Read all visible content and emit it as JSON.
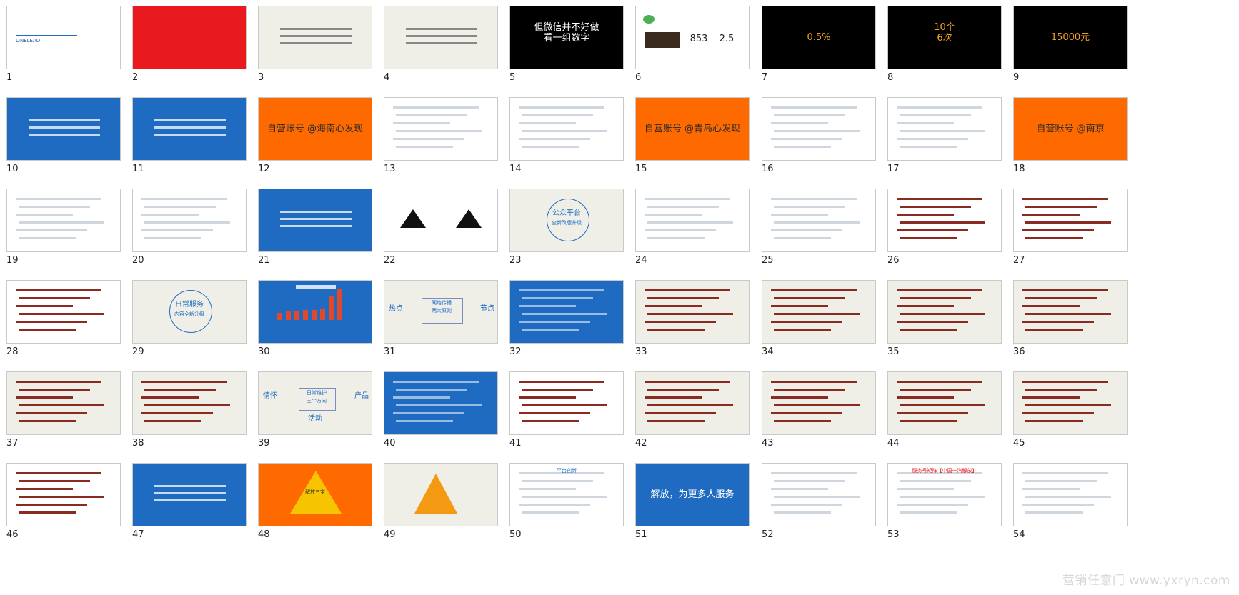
{
  "slides": [
    {
      "n": "1",
      "bg": "#ffffff",
      "kind": "text",
      "lines": [
        "LINELEAD"
      ],
      "color": "#2b57a1"
    },
    {
      "n": "2",
      "bg": "#e8191f",
      "kind": "calligraphy",
      "lines": [],
      "color": "#ffffff"
    },
    {
      "n": "3",
      "bg": "#efefe8",
      "kind": "text",
      "lines": [],
      "color": "#222"
    },
    {
      "n": "4",
      "bg": "#efefe8",
      "kind": "text",
      "lines": [],
      "color": "#222"
    },
    {
      "n": "5",
      "bg": "#000000",
      "kind": "text",
      "lines": [
        "但微信并不好做",
        "看一组数字"
      ],
      "color": "#ffffff"
    },
    {
      "n": "6",
      "bg": "#ffffff",
      "kind": "wechat",
      "lines": [
        "853",
        "2.5"
      ],
      "color": "#222"
    },
    {
      "n": "7",
      "bg": "#000000",
      "kind": "text",
      "lines": [
        "0.5%"
      ],
      "color": "#f0a11b"
    },
    {
      "n": "8",
      "bg": "#000000",
      "kind": "text",
      "lines": [
        "10个",
        "6次"
      ],
      "color": "#f0a11b"
    },
    {
      "n": "9",
      "bg": "#000000",
      "kind": "text",
      "lines": [
        "15000元"
      ],
      "color": "#f0a11b"
    },
    {
      "n": "10",
      "bg": "#1f6bc2",
      "kind": "text",
      "lines": [],
      "color": "#ffffff"
    },
    {
      "n": "11",
      "bg": "#1f6bc2",
      "kind": "text",
      "lines": [],
      "color": "#ffffff"
    },
    {
      "n": "12",
      "bg": "#ff6a00",
      "kind": "text",
      "lines": [
        "自营账号 @海南心发现"
      ],
      "color": "#2b2b2b"
    },
    {
      "n": "13",
      "bg": "#ffffff",
      "kind": "ui",
      "lines": [],
      "color": "#222"
    },
    {
      "n": "14",
      "bg": "#ffffff",
      "kind": "ui",
      "lines": [],
      "color": "#222"
    },
    {
      "n": "15",
      "bg": "#ff6a00",
      "kind": "text",
      "lines": [
        "自营账号 @青岛心发现"
      ],
      "color": "#2b2b2b"
    },
    {
      "n": "16",
      "bg": "#ffffff",
      "kind": "ui",
      "lines": [],
      "color": "#222"
    },
    {
      "n": "17",
      "bg": "#ffffff",
      "kind": "ui",
      "lines": [],
      "color": "#222"
    },
    {
      "n": "18",
      "bg": "#ff6a00",
      "kind": "text",
      "lines": [
        "自营账号 @南京"
      ],
      "color": "#2b2b2b"
    },
    {
      "n": "19",
      "bg": "#ffffff",
      "kind": "ui",
      "lines": [],
      "color": "#222"
    },
    {
      "n": "20",
      "bg": "#ffffff",
      "kind": "ui",
      "lines": [],
      "color": "#222"
    },
    {
      "n": "21",
      "bg": "#1f6bc2",
      "kind": "text",
      "lines": [],
      "color": "#ffffff"
    },
    {
      "n": "22",
      "bg": "#ffffff",
      "kind": "arrows",
      "lines": [],
      "color": "#222"
    },
    {
      "n": "23",
      "bg": "#efefe8",
      "kind": "circle",
      "lines": [
        "公众平台",
        "全新改版升级"
      ],
      "color": "#1f6bc2"
    },
    {
      "n": "24",
      "bg": "#ffffff",
      "kind": "ui",
      "lines": [],
      "color": "#222"
    },
    {
      "n": "25",
      "bg": "#ffffff",
      "kind": "ui",
      "lines": [],
      "color": "#222"
    },
    {
      "n": "26",
      "bg": "#ffffff",
      "kind": "photo",
      "lines": [],
      "color": "#222"
    },
    {
      "n": "27",
      "bg": "#ffffff",
      "kind": "photo",
      "lines": [],
      "color": "#222"
    },
    {
      "n": "28",
      "bg": "#ffffff",
      "kind": "photo",
      "lines": [],
      "color": "#222"
    },
    {
      "n": "29",
      "bg": "#efefe8",
      "kind": "circle",
      "lines": [
        "日常服务",
        "内容全新升级"
      ],
      "color": "#1f6bc2"
    },
    {
      "n": "30",
      "bg": "#1f6bc2",
      "kind": "chart",
      "lines": [],
      "color": "#ffffff"
    },
    {
      "n": "31",
      "bg": "#efefe8",
      "kind": "text",
      "lines": [
        "热点",
        "网络传播",
        "两大原则",
        "节点"
      ],
      "color": "#1f6bc2"
    },
    {
      "n": "32",
      "bg": "#1f6bc2",
      "kind": "ui",
      "lines": [],
      "color": "#ffffff"
    },
    {
      "n": "33",
      "bg": "#efefe8",
      "kind": "photo",
      "lines": [],
      "color": "#222"
    },
    {
      "n": "34",
      "bg": "#efefe8",
      "kind": "photo",
      "lines": [],
      "color": "#222"
    },
    {
      "n": "35",
      "bg": "#efefe8",
      "kind": "photo",
      "lines": [],
      "color": "#222"
    },
    {
      "n": "36",
      "bg": "#efefe8",
      "kind": "photo",
      "lines": [],
      "color": "#222"
    },
    {
      "n": "37",
      "bg": "#efefe8",
      "kind": "photo",
      "lines": [],
      "color": "#222"
    },
    {
      "n": "38",
      "bg": "#efefe8",
      "kind": "photo",
      "lines": [],
      "color": "#222"
    },
    {
      "n": "39",
      "bg": "#efefe8",
      "kind": "text",
      "lines": [
        "情怀",
        "日常维护",
        "三个方向",
        "产品",
        "活动"
      ],
      "color": "#1f6bc2"
    },
    {
      "n": "40",
      "bg": "#1f6bc2",
      "kind": "ui",
      "lines": [],
      "color": "#ffffff"
    },
    {
      "n": "41",
      "bg": "#ffffff",
      "kind": "photo",
      "lines": [],
      "color": "#222"
    },
    {
      "n": "42",
      "bg": "#efefe8",
      "kind": "photo",
      "lines": [],
      "color": "#222"
    },
    {
      "n": "43",
      "bg": "#efefe8",
      "kind": "photo",
      "lines": [],
      "color": "#222"
    },
    {
      "n": "44",
      "bg": "#efefe8",
      "kind": "photo",
      "lines": [],
      "color": "#222"
    },
    {
      "n": "45",
      "bg": "#efefe8",
      "kind": "photo",
      "lines": [],
      "color": "#222"
    },
    {
      "n": "46",
      "bg": "#ffffff",
      "kind": "photo",
      "lines": [],
      "color": "#222"
    },
    {
      "n": "47",
      "bg": "#1f6bc2",
      "kind": "text",
      "lines": [],
      "color": "#ffffff"
    },
    {
      "n": "48",
      "bg": "#ff6a00",
      "kind": "triangle",
      "lines": [
        "解放三宝"
      ],
      "color": "#ffffff"
    },
    {
      "n": "49",
      "bg": "#efefe8",
      "kind": "triangle2",
      "lines": [],
      "color": "#222"
    },
    {
      "n": "50",
      "bg": "#ffffff",
      "kind": "ui",
      "lines": [
        "平台创新"
      ],
      "color": "#1f6bc2"
    },
    {
      "n": "51",
      "bg": "#1f6bc2",
      "kind": "text",
      "lines": [
        "解放，为更多人服务"
      ],
      "color": "#ffffff"
    },
    {
      "n": "52",
      "bg": "#ffffff",
      "kind": "ui",
      "lines": [],
      "color": "#222"
    },
    {
      "n": "53",
      "bg": "#ffffff",
      "kind": "ui",
      "lines": [
        "服务号矩阵【中国一汽解放】"
      ],
      "color": "#e8191f"
    },
    {
      "n": "54",
      "bg": "#ffffff",
      "kind": "ui",
      "lines": [],
      "color": "#222"
    }
  ],
  "watermark": "营销任意门 www.yxryn.com"
}
